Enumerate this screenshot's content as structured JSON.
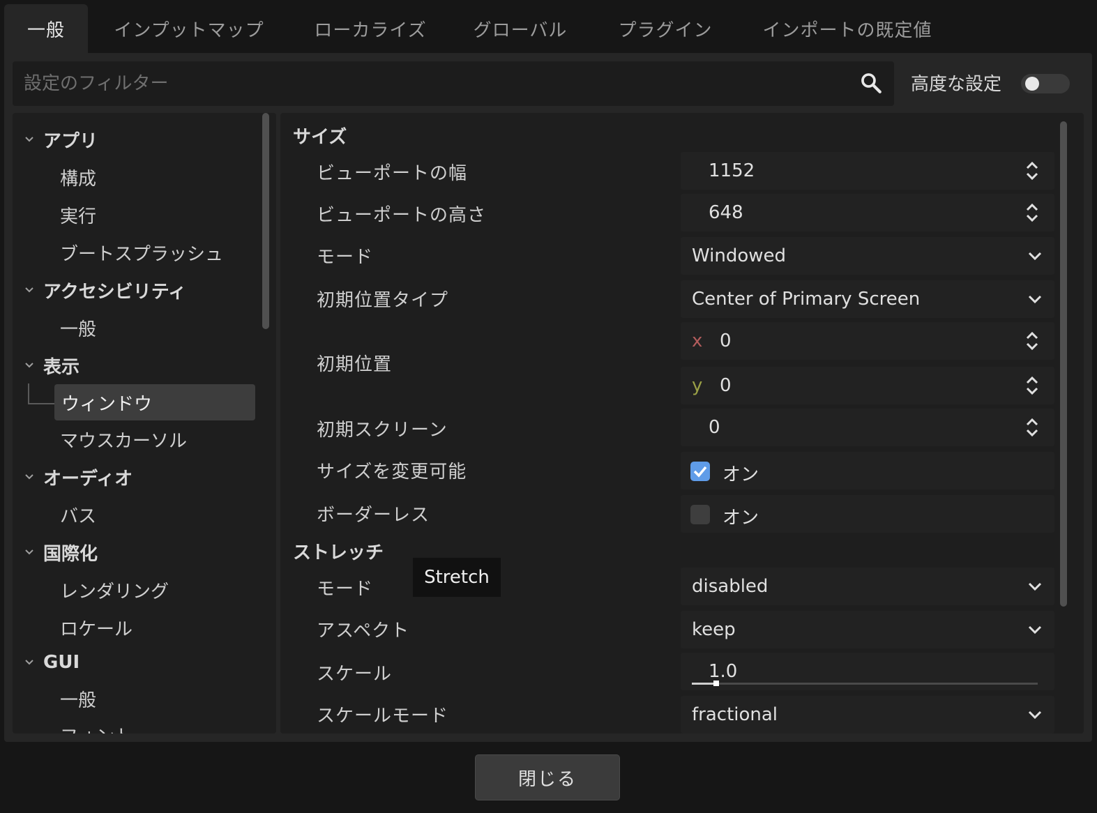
{
  "tabs": [
    {
      "label": "一般",
      "active": true
    },
    {
      "label": "インプットマップ"
    },
    {
      "label": "ローカライズ"
    },
    {
      "label": "グローバル"
    },
    {
      "label": "プラグイン"
    },
    {
      "label": "インポートの既定値"
    }
  ],
  "filter": {
    "placeholder": "設定のフィルター",
    "value": ""
  },
  "advanced": {
    "label": "高度な設定",
    "enabled": false
  },
  "sidebar": {
    "items": [
      {
        "label": "アプリ",
        "kind": "category"
      },
      {
        "label": "構成",
        "kind": "sub"
      },
      {
        "label": "実行",
        "kind": "sub"
      },
      {
        "label": "ブートスプラッシュ",
        "kind": "sub"
      },
      {
        "label": "アクセシビリティ",
        "kind": "category"
      },
      {
        "label": "一般",
        "kind": "sub"
      },
      {
        "label": "表示",
        "kind": "category"
      },
      {
        "label": "ウィンドウ",
        "kind": "sub",
        "selected": true
      },
      {
        "label": "マウスカーソル",
        "kind": "sub"
      },
      {
        "label": "オーディオ",
        "kind": "category"
      },
      {
        "label": "バス",
        "kind": "sub"
      },
      {
        "label": "国際化",
        "kind": "category"
      },
      {
        "label": "レンダリング",
        "kind": "sub"
      },
      {
        "label": "ロケール",
        "kind": "sub"
      },
      {
        "label": "GUI",
        "kind": "category"
      },
      {
        "label": "一般",
        "kind": "sub"
      },
      {
        "label": "フォント",
        "kind": "sub"
      }
    ]
  },
  "inspector": {
    "size_section": "サイズ",
    "viewport_width": {
      "label": "ビューポートの幅",
      "value": "1152"
    },
    "viewport_height": {
      "label": "ビューポートの高さ",
      "value": "648"
    },
    "mode": {
      "label": "モード",
      "value": "Windowed"
    },
    "initial_position_type": {
      "label": "初期位置タイプ",
      "value": "Center of Primary Screen"
    },
    "initial_position": {
      "label": "初期位置",
      "x_label": "x",
      "x": "0",
      "y_label": "y",
      "y": "0"
    },
    "initial_screen": {
      "label": "初期スクリーン",
      "value": "0"
    },
    "resizable": {
      "label": "サイズを変更可能",
      "checked": true,
      "text": "オン"
    },
    "borderless": {
      "label": "ボーダーレス",
      "checked": false,
      "text": "オン"
    },
    "stretch_section": "ストレッチ",
    "stretch_mode": {
      "label": "モード",
      "value": "disabled"
    },
    "aspect": {
      "label": "アスペクト",
      "value": "keep"
    },
    "scale": {
      "label": "スケール",
      "value": "1.0",
      "slider_fraction": 0.07
    },
    "scale_mode": {
      "label": "スケールモード",
      "value": "fractional"
    },
    "tooltip": "Stretch"
  },
  "close_label": "閉じる",
  "colors": {
    "accent": "#5f9ce8",
    "axis_x": "#b25c5c",
    "axis_y": "#9aa046"
  }
}
